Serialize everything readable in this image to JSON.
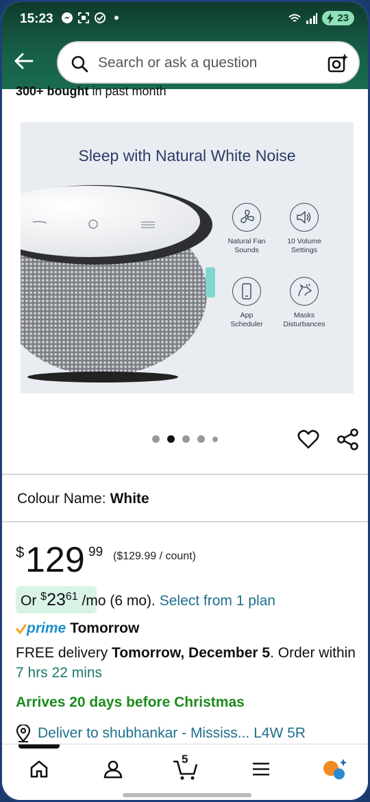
{
  "status_bar": {
    "time": "15:23",
    "battery": "23"
  },
  "search": {
    "placeholder": "Search or ask a question"
  },
  "product": {
    "bought_bold": "300+ bought",
    "bought_rest": " in past month",
    "hero": {
      "title": "Sleep with Natural White Noise",
      "features": [
        {
          "line1": "Natural Fan",
          "line2": "Sounds",
          "icon": "fan-icon"
        },
        {
          "line1": "10 Volume",
          "line2": "Settings",
          "icon": "volume-icon"
        },
        {
          "line1": "App",
          "line2": "Scheduler",
          "icon": "phone-icon"
        },
        {
          "line1": "Masks",
          "line2": "Disturbances",
          "icon": "dog-icon"
        }
      ]
    },
    "carousel": {
      "total": 5,
      "active_index": 1
    },
    "colour_label": "Colour Name:",
    "colour_value": "White",
    "price": {
      "currency": "$",
      "whole": "129",
      "fraction": "99",
      "unit_price": "($129.99 / count)"
    },
    "installment": {
      "prefix": "Or ",
      "currency": "$",
      "whole": "23",
      "fraction": "61",
      "suffix": " /mo (6 mo). ",
      "link": "Select from 1 plan"
    },
    "prime": {
      "badge": "prime",
      "label": "Tomorrow"
    },
    "delivery": {
      "part1": "FREE delivery ",
      "date_bold": "Tomorrow, December 5",
      "part2": ". Order within ",
      "countdown": "7 hrs 22 mins"
    },
    "arrives": "Arrives 20 days before Christmas",
    "deliver_to": "Deliver to shubhankar - Mississ... L4W 5R"
  },
  "bottom_nav": {
    "cart_count": "5",
    "items": [
      "home-icon",
      "account-icon",
      "cart-icon",
      "menu-icon",
      "rufus-icon"
    ]
  },
  "colors": {
    "header_green": "#17604a",
    "link_blue": "#1e6e8c",
    "prime_blue": "#1a8fc9",
    "christmas_green": "#1c8a1c",
    "emi_pill": "#d9f3e7"
  }
}
